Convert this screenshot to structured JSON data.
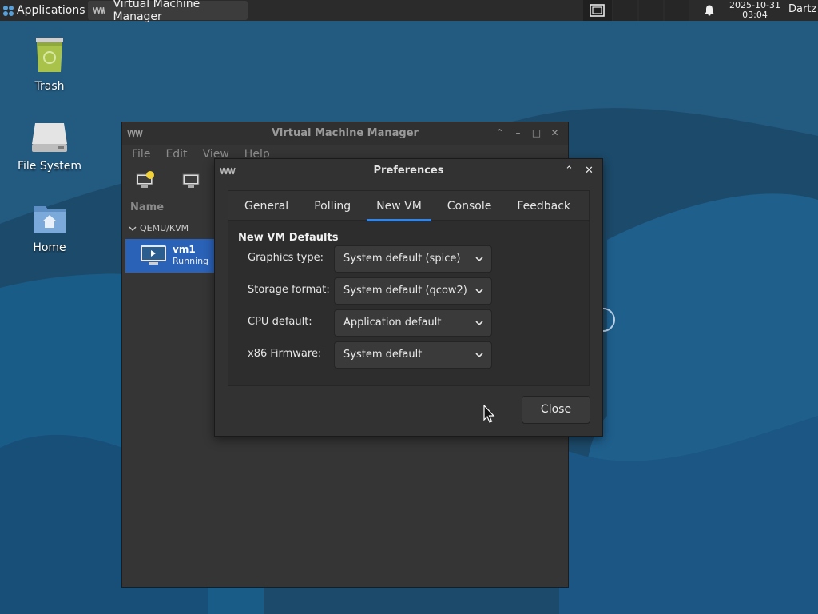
{
  "panel": {
    "applications_label": "Applications",
    "task_title": "Virtual Machine Manager",
    "clock_date": "2025-10-31",
    "clock_time": "03:04",
    "user": "Dartz"
  },
  "desktop_icons": [
    {
      "label": "Trash",
      "icon": "trash-icon"
    },
    {
      "label": "File System",
      "icon": "drive-icon"
    },
    {
      "label": "Home",
      "icon": "home-folder-icon"
    }
  ],
  "vmm": {
    "title": "Virtual Machine Manager",
    "menu": [
      "File",
      "Edit",
      "View",
      "Help"
    ],
    "list_header": "Name",
    "group": "QEMU/KVM",
    "vm": {
      "name": "vm1",
      "status": "Running"
    }
  },
  "prefs": {
    "title": "Preferences",
    "tabs": [
      {
        "label": "General",
        "active": false
      },
      {
        "label": "Polling",
        "active": false
      },
      {
        "label": "New VM",
        "active": true
      },
      {
        "label": "Console",
        "active": false
      },
      {
        "label": "Feedback",
        "active": false
      }
    ],
    "section_title": "New VM Defaults",
    "fields": [
      {
        "label": "Graphics type:",
        "value": "System default (spice)"
      },
      {
        "label": "Storage format:",
        "value": "System default (qcow2)"
      },
      {
        "label": "CPU default:",
        "value": "Application default"
      },
      {
        "label": "x86 Firmware:",
        "value": "System default"
      }
    ],
    "close_label": "Close"
  },
  "colors": {
    "accent": "#3584e4",
    "selection": "#2a62b8",
    "desktop_blue": "#1f4f70"
  }
}
